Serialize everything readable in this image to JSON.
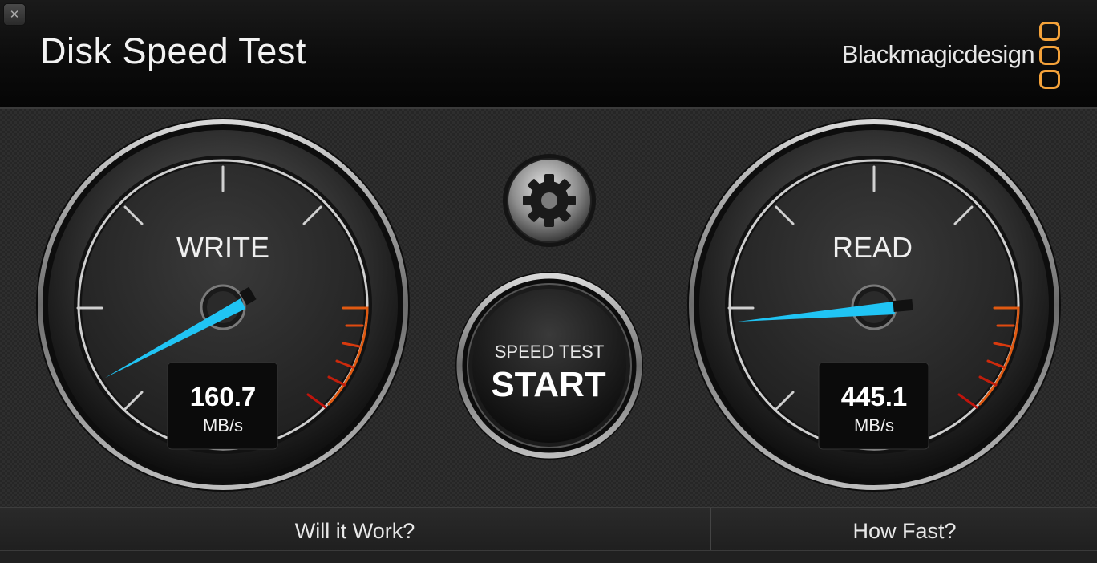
{
  "window": {
    "title": "Disk Speed Test",
    "close_icon": "close-icon"
  },
  "brand": {
    "name": "Blackmagicdesign",
    "logo_icon": "blackmagic-logo-icon",
    "logo_color": "#f4a23a"
  },
  "settings": {
    "icon": "gear-icon"
  },
  "start_button": {
    "line1": "SPEED TEST",
    "line2": "START"
  },
  "write_gauge": {
    "label": "WRITE",
    "value": "160.7",
    "unit": "MB/s",
    "needle_color": "#20c4f4"
  },
  "read_gauge": {
    "label": "READ",
    "value": "445.1",
    "unit": "MB/s",
    "needle_color": "#20c4f4"
  },
  "footer": {
    "tab_work": "Will it Work?",
    "tab_fast": "How Fast?"
  }
}
